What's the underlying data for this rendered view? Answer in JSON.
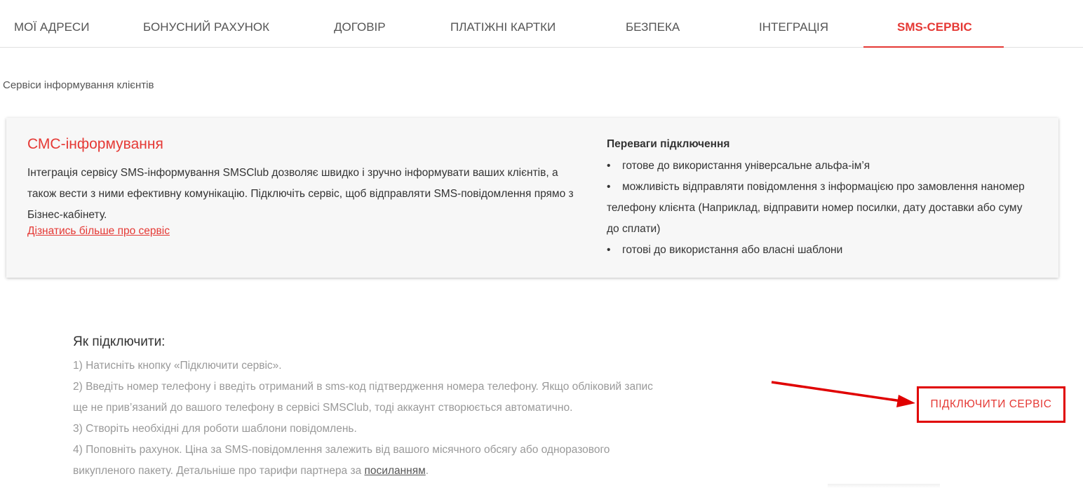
{
  "tabs": [
    {
      "label": "МОЇ АДРЕСИ"
    },
    {
      "label": "БОНУСНИЙ РАХУНОК"
    },
    {
      "label": "ДОГОВІР"
    },
    {
      "label": "ПЛАТІЖНІ КАРТКИ"
    },
    {
      "label": "БЕЗПЕКА"
    },
    {
      "label": "ІНТЕГРАЦІЯ"
    },
    {
      "label": "SMS-СЕРВІС",
      "active": true
    }
  ],
  "section_title": "Сервіси інформування клієнтів",
  "card": {
    "title": "СМС-інформування",
    "description": "Інтеграція сервісу SMS-інформування SMSClub дозволяє швидко і зручно інформувати ваших клієнтів, а також вести з ними ефективну комунікацію. Підключіть сервіс, щоб відправляти SMS-повідомлення прямо з Бізнес-кабінету.",
    "link": "Дізнатись більше про сервіс",
    "benefits_title": "Переваги підключення",
    "benefits": [
      "готове до використання універсальне альфа-ім’я",
      "можливість відправляти повідомлення з інформацією про замовлення наномер телефону клієнта (Наприклад, відправити номер посилки, дату доставки або суму до сплати)",
      "готові до використання або власні шаблони"
    ]
  },
  "how": {
    "title": "Як підключити:",
    "step1": "1) Натисніть кнопку «Підключити сервіс».",
    "step2": "2) Введіть номер телефону і введіть отриманий в sms-код підтвердження номера телефону. Якщо обліковий запис ще не прив’язаний до вашого телефону в сервісі SMSClub, тоді аккаунт створюється автоматично.",
    "step3": "3) Створіть необхідні для роботи шаблони повідомлень.",
    "step4_prefix": "4) Поповніть рахунок. Ціна за SMS-повідомлення залежить від вашого місячного обсягу або одноразового викупленого пакету. Детальніше про тарифи партнера за ",
    "step4_link": "посиланням",
    "step4_suffix": "."
  },
  "connect_button": "ПІДКЛЮЧИТИ СЕРВІС",
  "colors": {
    "accent": "#e53935",
    "annotation": "#e00000"
  }
}
